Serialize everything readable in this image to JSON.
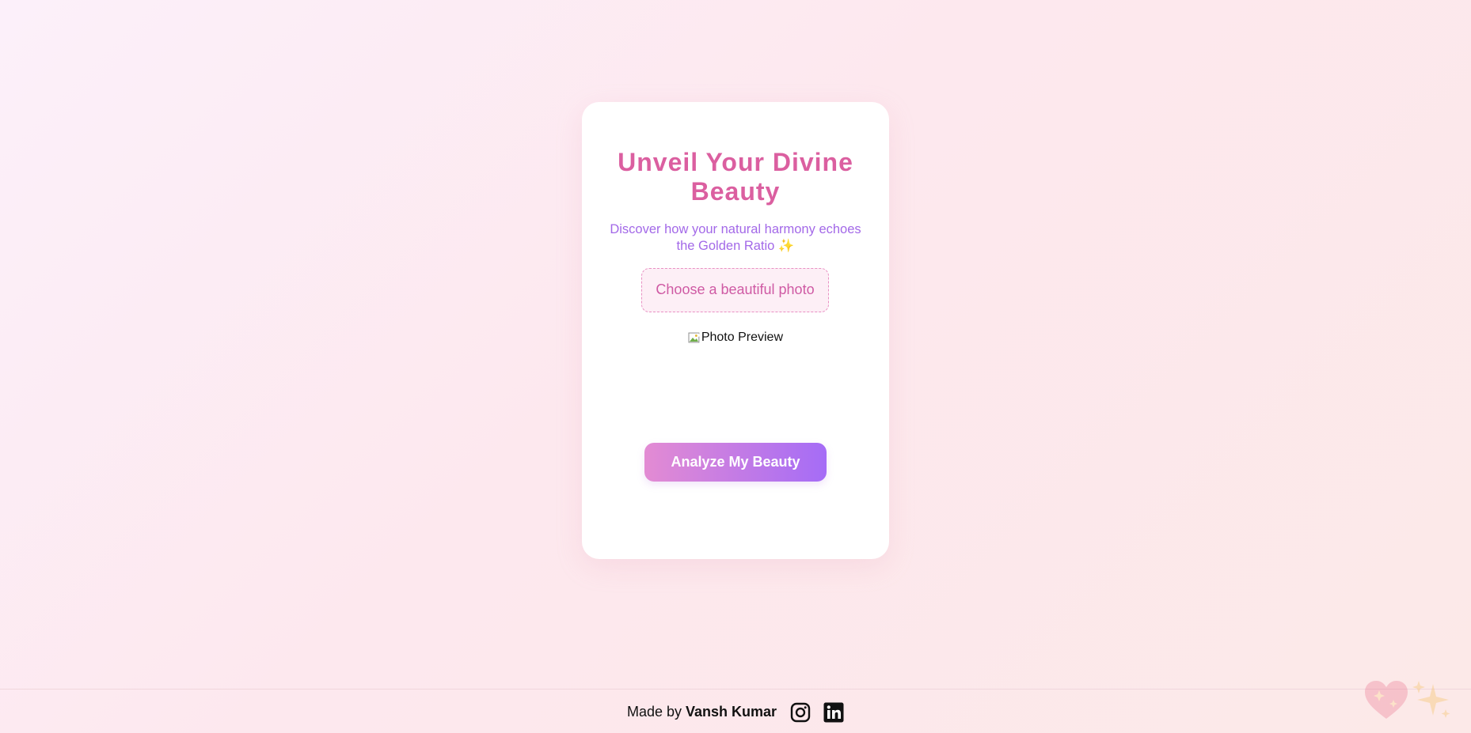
{
  "card": {
    "title": "Unveil Your Divine Beauty",
    "subtitle": "Discover how your natural harmony echoes the Golden Ratio ✨",
    "upload_label": "Choose a beautiful photo",
    "preview_alt": "Photo Preview",
    "analyze_label": "Analyze My Beauty"
  },
  "footer": {
    "made_by": "Made by",
    "author": "Vansh Kumar",
    "icons": [
      "instagram-icon",
      "linkedin-icon"
    ]
  },
  "decorations": [
    "heart-icon",
    "sparkles-icon"
  ],
  "colors": {
    "title": "#db5fa0",
    "subtitle": "#a369e8",
    "upload_border": "#e990c3",
    "button_start": "#e38bd3",
    "button_end": "#a56cf6"
  }
}
